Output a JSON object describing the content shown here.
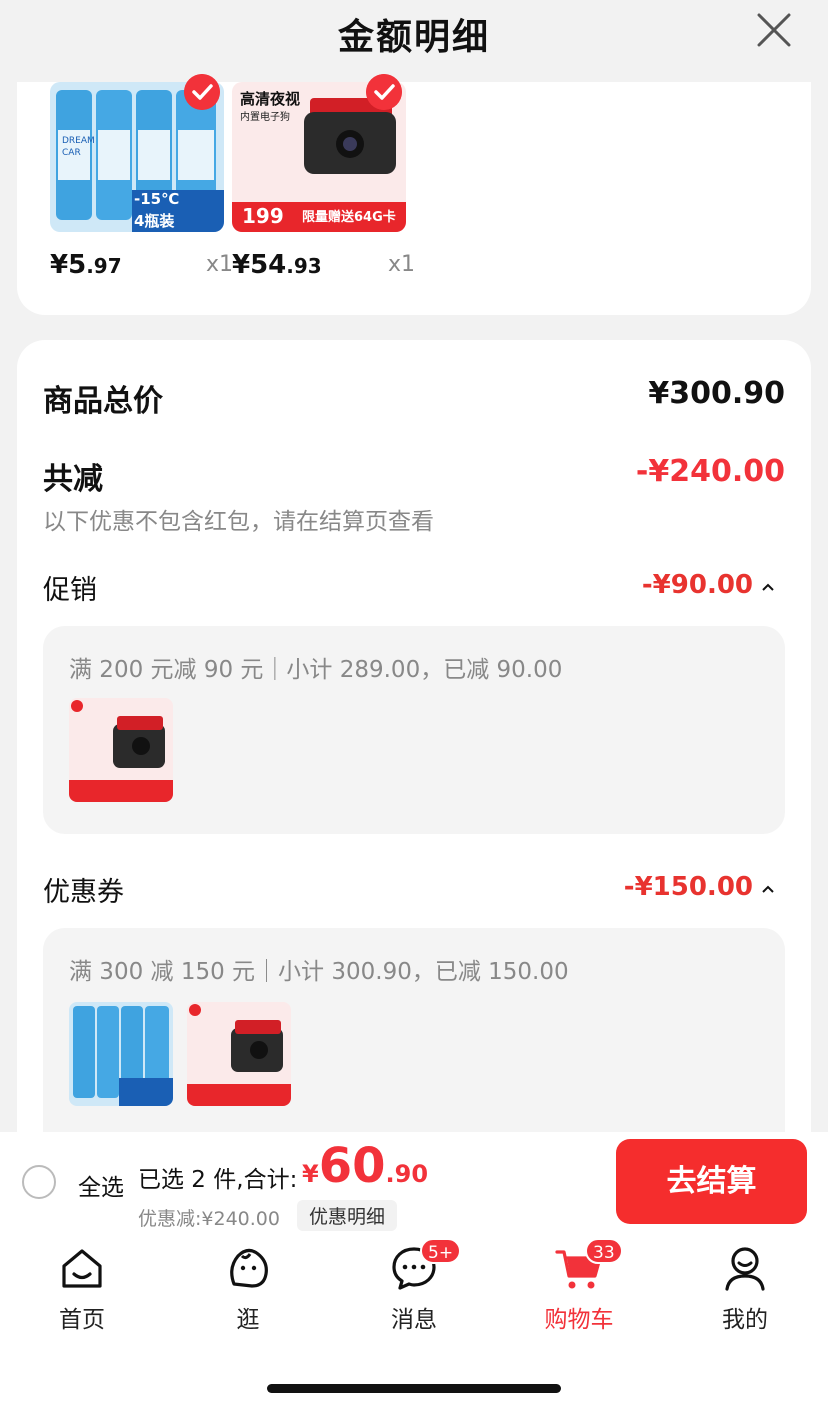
{
  "header": {
    "title": "金额明细"
  },
  "products": [
    {
      "price_int": "¥5",
      "price_dec": ".97",
      "qty": "x1",
      "thumb_text": [
        "DREAM",
        "CAR",
        "-15℃",
        "4瓶装"
      ]
    },
    {
      "price_int": "¥54",
      "price_dec": ".93",
      "qty": "x1",
      "thumb_text": [
        "高清夜视",
        "内置电子狗",
        "199",
        "限量赠送64G卡"
      ]
    }
  ],
  "summary": {
    "total_label": "商品总价",
    "total_value": "¥300.90",
    "reduce_label": "共减",
    "reduce_value": "-¥240.00",
    "note": "以下优惠不包含红包，请在结算页查看",
    "promo": {
      "label": "促销",
      "value": "-¥90.00",
      "detail": "满 200 元减 90 元｜小计 289.00，已减 90.00"
    },
    "coupon": {
      "label": "优惠券",
      "value": "-¥150.00",
      "detail": "满 300 减 150 元｜小计 300.90，已减 150.00"
    }
  },
  "checkout": {
    "select_all": "全选",
    "selected_text": "已选 2 件,合计:",
    "total_currency": "¥",
    "total_int": "60",
    "total_dec": ".90",
    "discount_text": "优惠减:¥240.00",
    "detail_chip": "优惠明细",
    "button": "去结算"
  },
  "tabs": [
    {
      "label": "首页",
      "icon": "home-icon"
    },
    {
      "label": "逛",
      "icon": "discover-icon"
    },
    {
      "label": "消息",
      "icon": "message-icon",
      "badge": "5+"
    },
    {
      "label": "购物车",
      "icon": "cart-icon",
      "badge": "33",
      "active": true
    },
    {
      "label": "我的",
      "icon": "profile-icon"
    }
  ],
  "colors": {
    "accent": "#f2323a",
    "discount": "#e8332f",
    "background": "#f2f2f2"
  }
}
